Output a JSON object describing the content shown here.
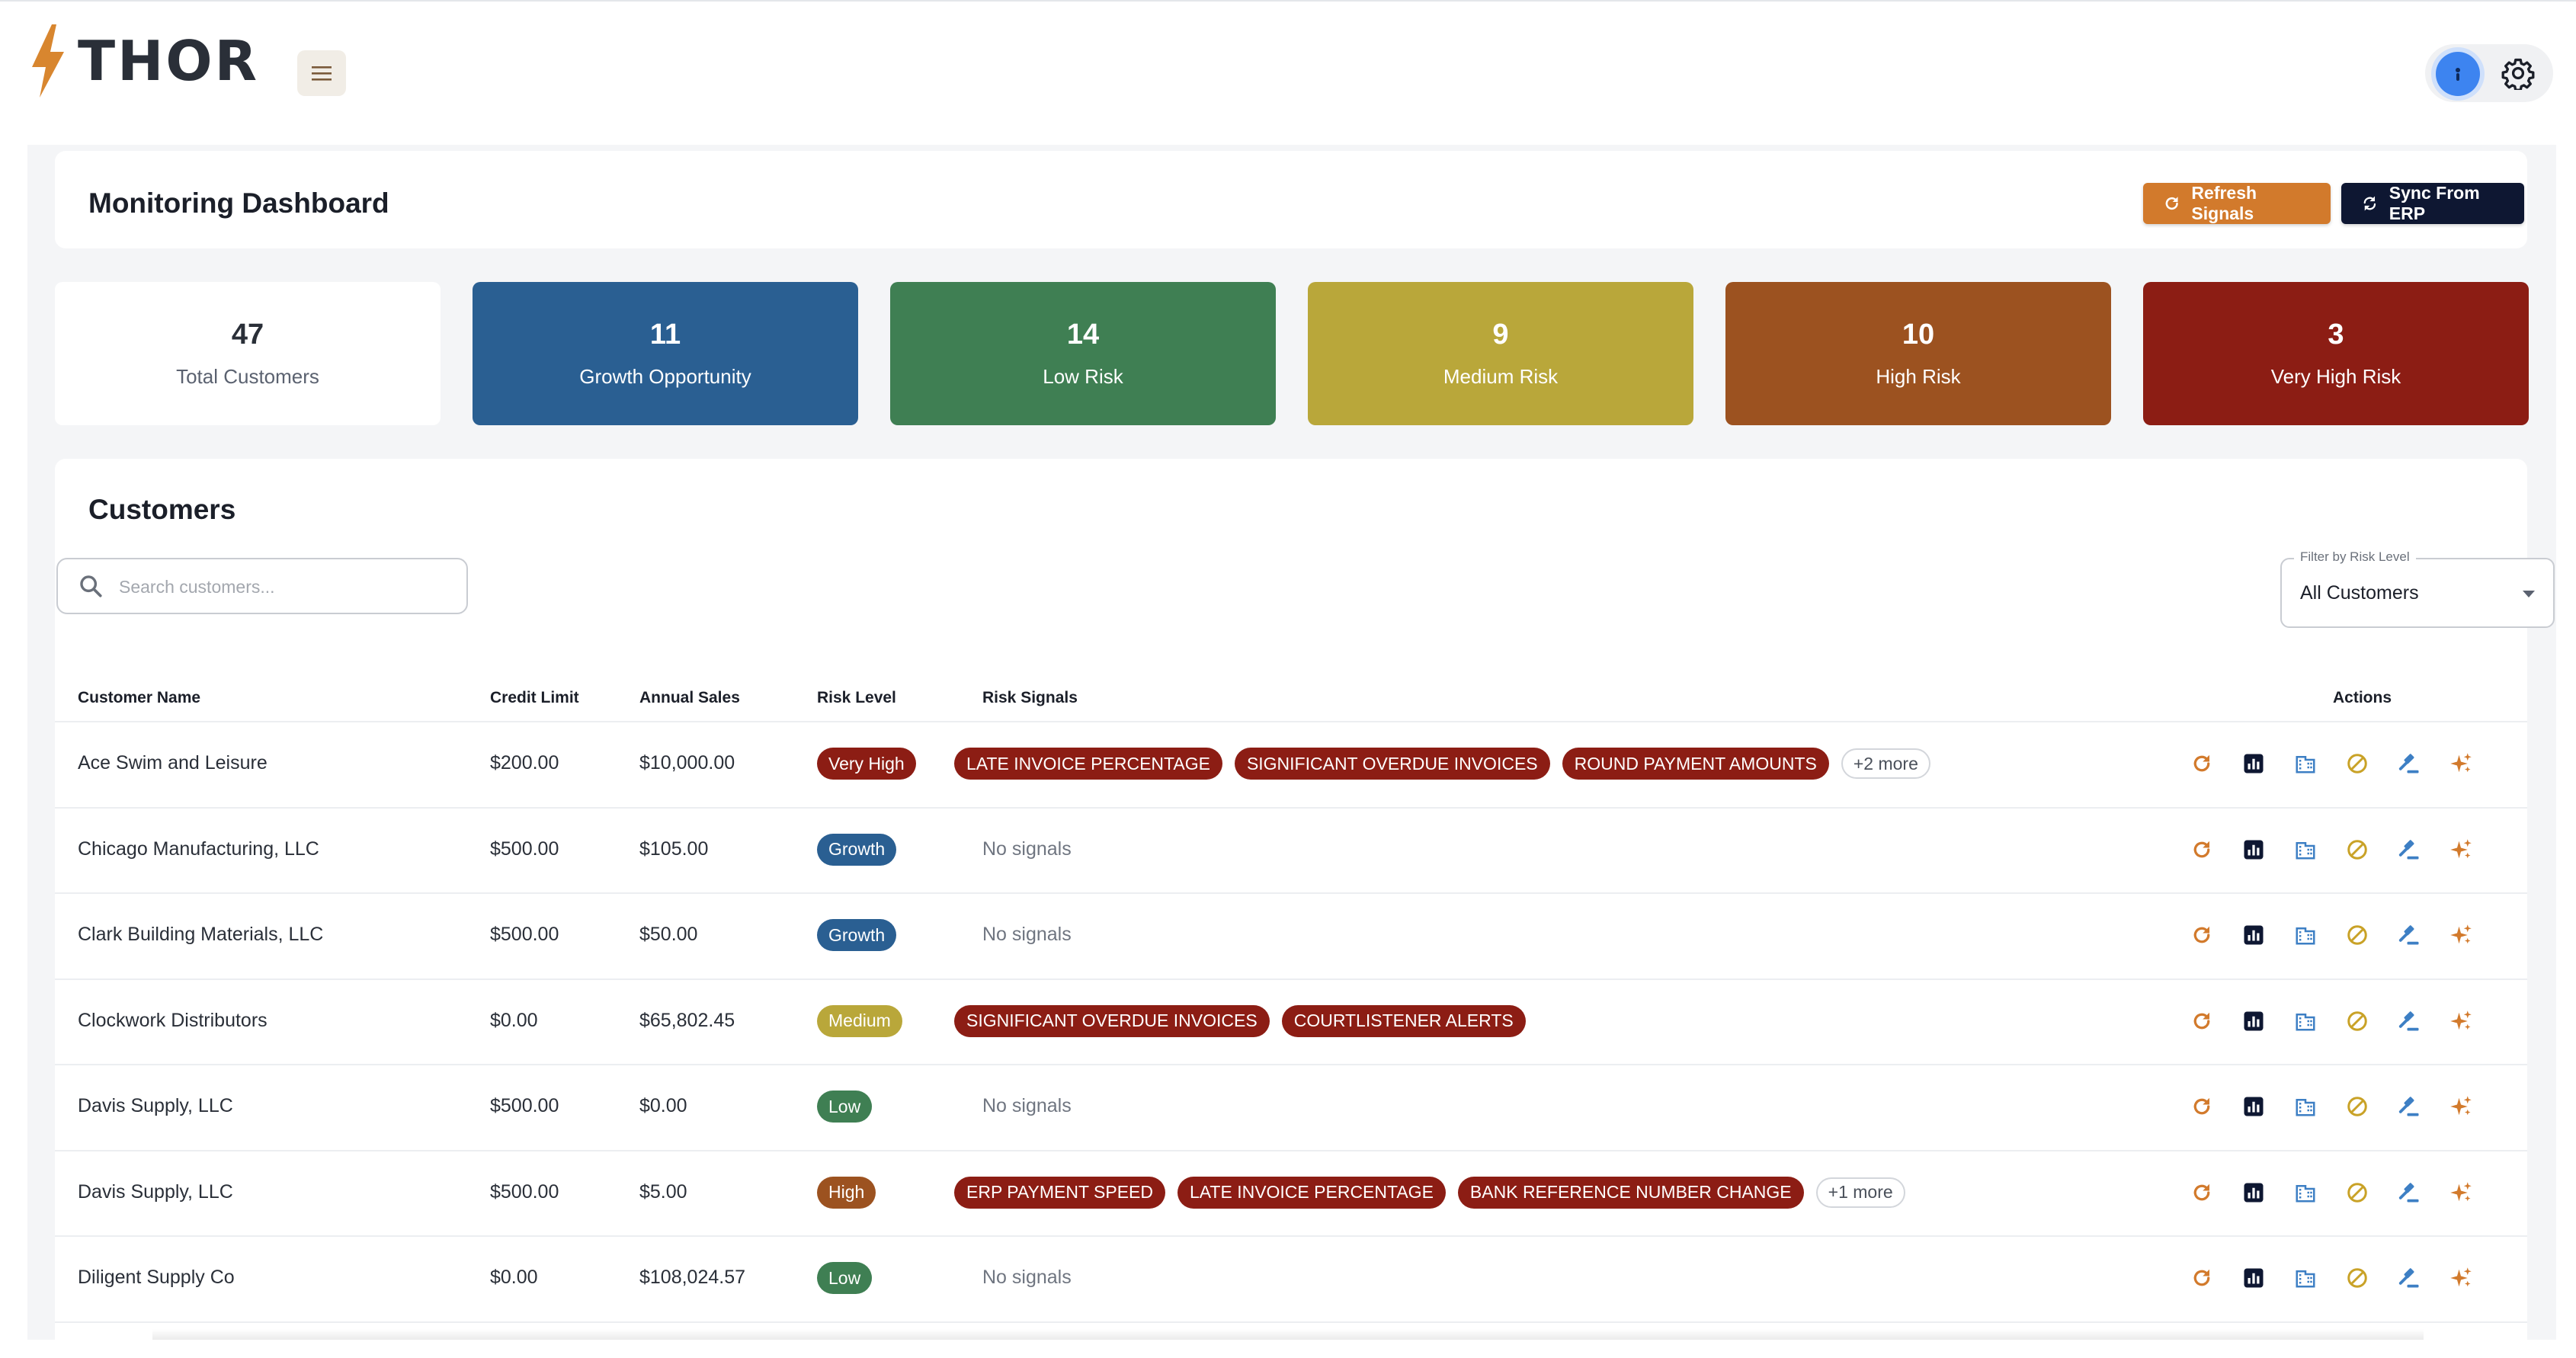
{
  "app": {
    "logo_text": "THOR"
  },
  "header": {
    "title": "Monitoring Dashboard",
    "refresh_label": "Refresh Signals",
    "sync_label": "Sync From ERP"
  },
  "stats": [
    {
      "value": "47",
      "label": "Total Customers",
      "color": "#ffffff"
    },
    {
      "value": "11",
      "label": "Growth Opportunity",
      "color": "#2a5f92"
    },
    {
      "value": "14",
      "label": "Low Risk",
      "color": "#3f7f53"
    },
    {
      "value": "9",
      "label": "Medium Risk",
      "color": "#b9a73a"
    },
    {
      "value": "10",
      "label": "High Risk",
      "color": "#9c5220"
    },
    {
      "value": "3",
      "label": "Very High Risk",
      "color": "#8c1d14"
    }
  ],
  "customers": {
    "title": "Customers",
    "search_placeholder": "Search customers...",
    "filter_label": "Filter by Risk Level",
    "filter_value": "All Customers",
    "columns": [
      "Customer Name",
      "Credit Limit",
      "Annual Sales",
      "Risk Level",
      "Risk Signals",
      "Actions"
    ],
    "no_signals_text": "No signals",
    "rows": [
      {
        "name": "Ace Swim and Leisure",
        "credit": "$200.00",
        "sales": "$10,000.00",
        "risk": "Very High",
        "risk_color": "#8c1d14",
        "signals": [
          "LATE INVOICE PERCENTAGE",
          "SIGNIFICANT OVERDUE INVOICES",
          "ROUND PAYMENT AMOUNTS"
        ],
        "more": "+2 more"
      },
      {
        "name": "Chicago Manufacturing, LLC",
        "credit": "$500.00",
        "sales": "$105.00",
        "risk": "Growth",
        "risk_color": "#2a5f92",
        "signals": [],
        "more": ""
      },
      {
        "name": "Clark Building Materials, LLC",
        "credit": "$500.00",
        "sales": "$50.00",
        "risk": "Growth",
        "risk_color": "#2a5f92",
        "signals": [],
        "more": ""
      },
      {
        "name": "Clockwork Distributors",
        "credit": "$0.00",
        "sales": "$65,802.45",
        "risk": "Medium",
        "risk_color": "#b9a73a",
        "signals": [
          "SIGNIFICANT OVERDUE INVOICES",
          "COURTLISTENER ALERTS"
        ],
        "more": ""
      },
      {
        "name": "Davis Supply, LLC",
        "credit": "$500.00",
        "sales": "$0.00",
        "risk": "Low",
        "risk_color": "#3f7f53",
        "signals": [],
        "more": ""
      },
      {
        "name": "Davis Supply, LLC",
        "credit": "$500.00",
        "sales": "$5.00",
        "risk": "High",
        "risk_color": "#9c5220",
        "signals": [
          "ERP PAYMENT SPEED",
          "LATE INVOICE PERCENTAGE",
          "BANK REFERENCE NUMBER CHANGE"
        ],
        "more": "+1 more"
      },
      {
        "name": "Diligent Supply Co",
        "credit": "$0.00",
        "sales": "$108,024.57",
        "risk": "Low",
        "risk_color": "#3f7f53",
        "signals": [],
        "more": ""
      }
    ]
  },
  "action_icons": [
    {
      "name": "refresh-icon",
      "color": "#d27a2c"
    },
    {
      "name": "analytics-icon",
      "color": "#0e1732"
    },
    {
      "name": "building-icon",
      "color": "#3d7fc4"
    },
    {
      "name": "block-icon",
      "color": "#c9a227"
    },
    {
      "name": "gavel-icon",
      "color": "#3d7fc4"
    },
    {
      "name": "sparkle-icon",
      "color": "#d27a2c"
    }
  ]
}
